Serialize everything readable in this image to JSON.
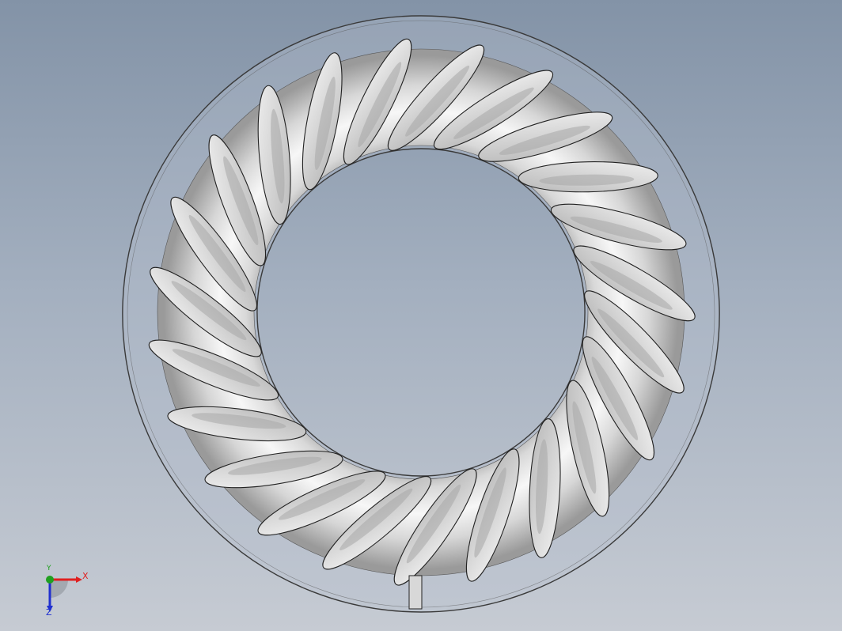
{
  "viewport": {
    "background_top": "#8393a7",
    "background_bottom": "#c6cbd3"
  },
  "model": {
    "blade_count": 23,
    "colors": {
      "torus_light": "#f4f4f4",
      "torus_mid": "#d2d2d2",
      "torus_dark": "#9b9b9b",
      "blade_fill": "#dadada",
      "blade_shade": "#a8a8a8",
      "outline": "#222222",
      "housing_edge": "#3a3a3a"
    }
  },
  "triad": {
    "x_label": "X",
    "y_label": "Y",
    "z_label": "Z",
    "x_color": "#e02020",
    "y_color": "#20a020",
    "z_color": "#2030d0"
  }
}
